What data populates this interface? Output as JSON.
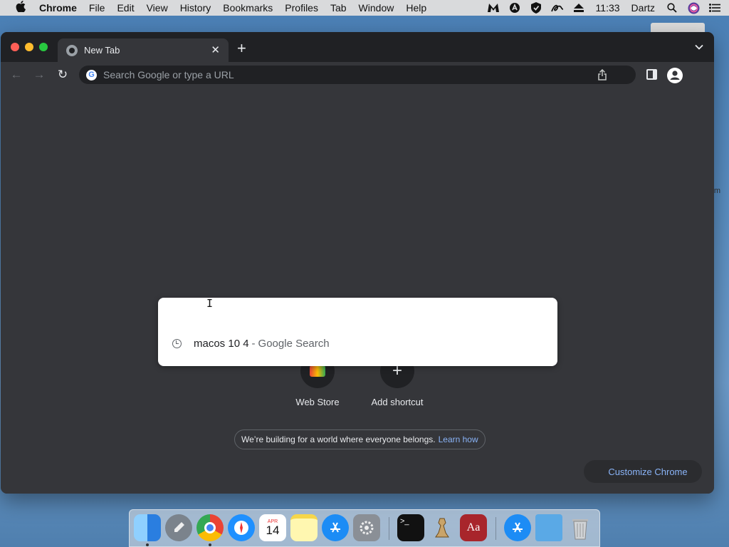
{
  "menubar": {
    "apple_icon": "apple-icon",
    "app_name": "Chrome",
    "items": [
      "File",
      "Edit",
      "View",
      "History",
      "Bookmarks",
      "Profiles",
      "Tab",
      "Window",
      "Help"
    ],
    "clock": "11:33",
    "user": "Dartz",
    "status_icons": [
      "malwarebytes-icon",
      "adguard-icon",
      "shield-check-icon",
      "signature-icon",
      "eject-icon",
      "search-icon",
      "siri-icon",
      "control-center-icon"
    ]
  },
  "desktop": {
    "edge_text": "m"
  },
  "tab": {
    "title": "New Tab",
    "close_glyph": "✕",
    "new_tab_glyph": "+"
  },
  "toolbar": {
    "back_glyph": "←",
    "forward_glyph": "→",
    "reload_glyph": "↻",
    "omnibox_placeholder": "Search Google or type a URL",
    "google_letter": "G"
  },
  "ntp": {
    "shortcuts": [
      {
        "label": "Web Store"
      },
      {
        "label": "Add shortcut",
        "glyph": "+"
      }
    ],
    "belong_text": "We’re building for a world where everyone belongs.",
    "learn_how": "Learn how",
    "customize_label": "Customize Chrome"
  },
  "dropdown": {
    "suggestion_query": "macos 10 4",
    "separator": "-",
    "suggestion_provider": "Google Search",
    "ibeam_glyph": "I"
  },
  "dock": {
    "calendar_month": "APR",
    "calendar_day": "14",
    "dictionary_text": "Aa",
    "terminal_text": ">_",
    "items": [
      "finder-icon",
      "launchpad-icon",
      "chrome-icon",
      "safari-icon",
      "calendar-icon",
      "notes-icon",
      "app-store-icon",
      "system-preferences-icon",
      "terminal-icon",
      "chess-icon",
      "dictionary-icon",
      "app-store-folder-icon",
      "folder-icon",
      "trash-icon"
    ]
  },
  "colors": {
    "accent_link": "#8ab4f8",
    "window_bg": "#35363a",
    "tabstrip_bg": "#202124"
  }
}
